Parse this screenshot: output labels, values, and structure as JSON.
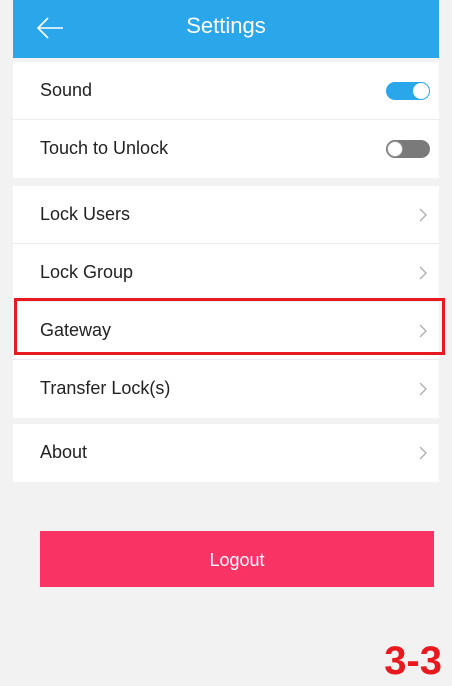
{
  "header": {
    "title": "Settings",
    "back_icon": "arrow-left-icon"
  },
  "toggles": [
    {
      "label": "Sound",
      "state": "on"
    },
    {
      "label": "Touch to Unlock",
      "state": "off"
    }
  ],
  "menu": [
    {
      "label": "Lock Users"
    },
    {
      "label": "Lock Group"
    },
    {
      "label": "Gateway",
      "highlighted": true
    },
    {
      "label": "Transfer Lock(s)"
    }
  ],
  "about": {
    "label": "About"
  },
  "logout_label": "Logout",
  "step_label": "3-3",
  "colors": {
    "accent": "#2aa6ea",
    "logout": "#fa3365",
    "highlight": "#e8191f",
    "background": "#f2f2f2"
  }
}
